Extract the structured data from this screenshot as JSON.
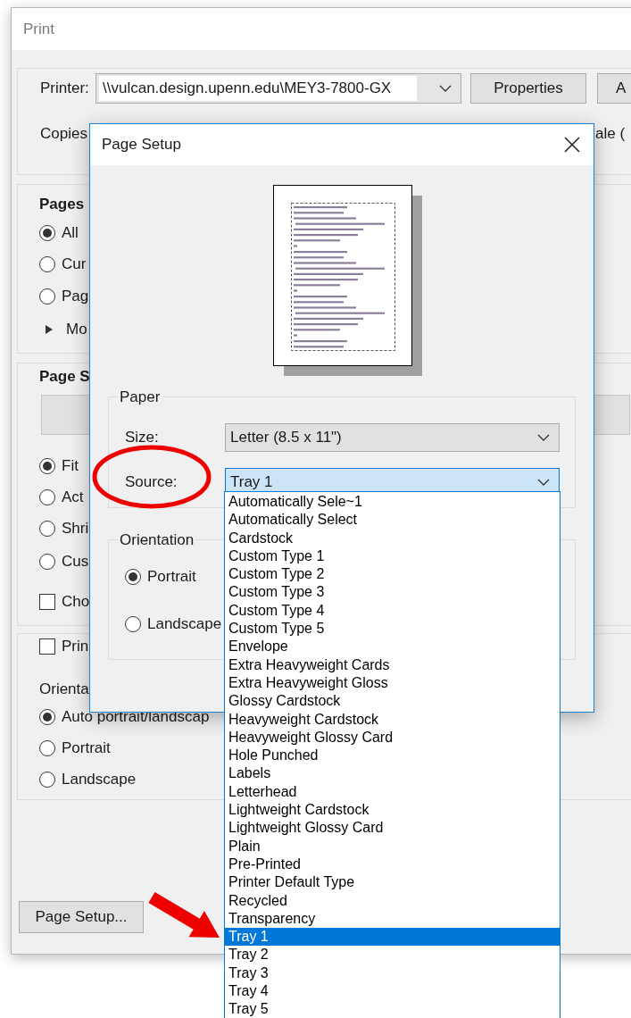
{
  "print_window": {
    "title": "Print",
    "printer": {
      "label": "Printer:",
      "value": "\\\\vulcan.design.upenn.edu\\MEY3-7800-GX"
    },
    "buttons": [
      "Properties",
      "A"
    ],
    "copies_label": "Copies",
    "scale_label": "ale (",
    "pages_group": {
      "title": "Pages",
      "options": [
        {
          "label": "All",
          "selected": true
        },
        {
          "label": "Cur",
          "selected": false
        },
        {
          "label": "Pag",
          "selected": false
        }
      ],
      "more": {
        "label": "Mo",
        "expanded": false
      }
    },
    "sizing_group": {
      "title": "Page S",
      "options": [
        {
          "label": "Fit",
          "selected": true
        },
        {
          "label": "Act",
          "selected": false
        },
        {
          "label": "Shri",
          "selected": false
        },
        {
          "label": "Cus",
          "selected": false
        }
      ],
      "checkbox": {
        "label": "Cho",
        "checked": false
      }
    },
    "orientation_group": {
      "checkbox": {
        "label": "Prin",
        "checked": false
      },
      "title": "Orienta",
      "options": [
        {
          "label": "Auto portrait/landscap",
          "selected": true
        },
        {
          "label": "Portrait",
          "selected": false
        },
        {
          "label": "Landscape",
          "selected": false
        }
      ]
    },
    "page_setup_button": "Page Setup..."
  },
  "page_setup_dialog": {
    "title": "Page Setup",
    "paper": {
      "title": "Paper",
      "size": {
        "label": "Size:",
        "value": "Letter (8.5 x 11\")"
      },
      "source": {
        "label": "Source:",
        "value": "Tray 1",
        "open": true
      }
    },
    "orientation": {
      "title": "Orientation",
      "options": [
        {
          "label": "Portrait",
          "selected": true
        },
        {
          "label": "Landscape",
          "selected": false
        }
      ]
    },
    "source_list": [
      {
        "label": "Automatically Sele~1",
        "selected": false
      },
      {
        "label": "Automatically Select",
        "selected": false
      },
      {
        "label": "Cardstock",
        "selected": false
      },
      {
        "label": "Custom Type 1",
        "selected": false
      },
      {
        "label": "Custom Type 2",
        "selected": false
      },
      {
        "label": "Custom Type 3",
        "selected": false
      },
      {
        "label": "Custom Type 4",
        "selected": false
      },
      {
        "label": "Custom Type 5",
        "selected": false
      },
      {
        "label": "Envelope",
        "selected": false
      },
      {
        "label": "Extra Heavyweight Cards",
        "selected": false
      },
      {
        "label": "Extra Heavyweight Gloss",
        "selected": false
      },
      {
        "label": "Glossy Cardstock",
        "selected": false
      },
      {
        "label": "Heavyweight Cardstock",
        "selected": false
      },
      {
        "label": "Heavyweight Glossy Card",
        "selected": false
      },
      {
        "label": "Hole Punched",
        "selected": false
      },
      {
        "label": "Labels",
        "selected": false
      },
      {
        "label": "Letterhead",
        "selected": false
      },
      {
        "label": "Lightweight Cardstock",
        "selected": false
      },
      {
        "label": "Lightweight Glossy Card",
        "selected": false
      },
      {
        "label": "Plain",
        "selected": false
      },
      {
        "label": "Pre-Printed",
        "selected": false
      },
      {
        "label": "Printer Default Type",
        "selected": false
      },
      {
        "label": "Recycled",
        "selected": false
      },
      {
        "label": "Transparency",
        "selected": false
      },
      {
        "label": "Tray 1",
        "selected": true
      },
      {
        "label": "Tray 2",
        "selected": false
      },
      {
        "label": "Tray 3",
        "selected": false
      },
      {
        "label": "Tray 4",
        "selected": false
      },
      {
        "label": "Tray 5",
        "selected": false
      }
    ]
  }
}
